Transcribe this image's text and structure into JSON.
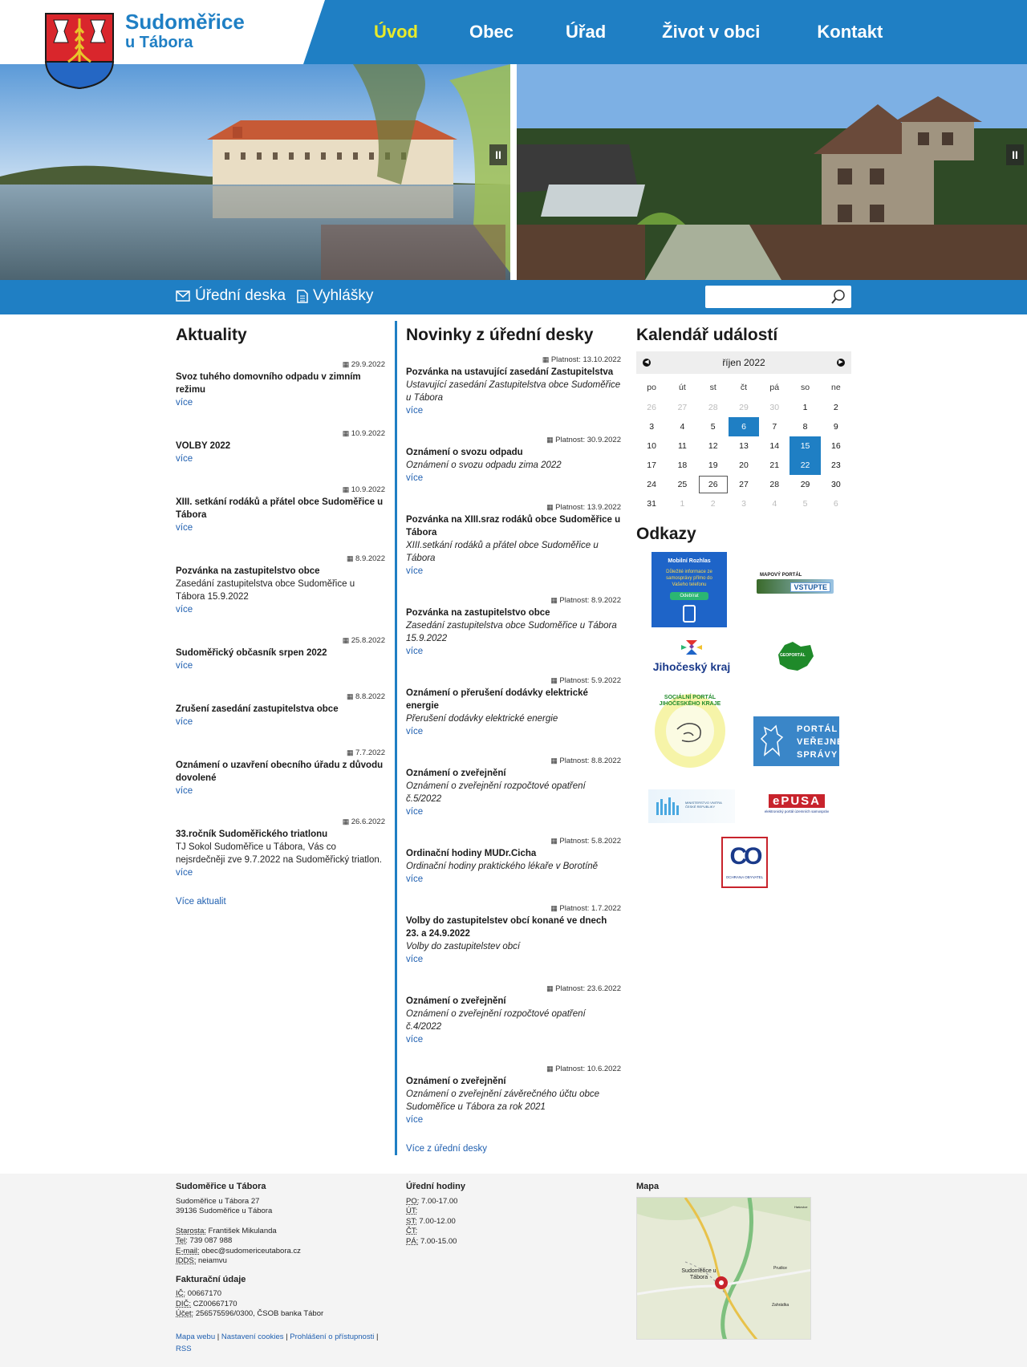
{
  "site": {
    "name_line1": "Sudoměřice",
    "name_line2": "u Tábora"
  },
  "nav": [
    {
      "label": "Úvod",
      "active": true
    },
    {
      "label": "Obec"
    },
    {
      "label": "Úřad"
    },
    {
      "label": "Život v obci"
    },
    {
      "label": "Kontakt"
    }
  ],
  "bar": {
    "official_board": "Úřední deska",
    "decrees": "Vyhlášky",
    "search_placeholder": ""
  },
  "aktuality": {
    "title": "Aktuality",
    "items": [
      {
        "date": "29.9.2022",
        "title": "Svoz tuhého domovního odpadu v zimním režimu",
        "desc": "",
        "more": "více"
      },
      {
        "date": "10.9.2022",
        "title": "VOLBY 2022",
        "desc": "",
        "more": "více"
      },
      {
        "date": "10.9.2022",
        "title": "XIII. setkání rodáků a přátel obce Sudoměřice u Tábora",
        "desc": "",
        "more": "více"
      },
      {
        "date": "8.9.2022",
        "title": "Pozvánka na zastupitelstvo obce",
        "desc": "Zasedání zastupitelstva obce Sudoměřice u Tábora 15.9.2022",
        "more": "více"
      },
      {
        "date": "25.8.2022",
        "title": "Sudoměřický občasník srpen 2022",
        "desc": "",
        "more": "více"
      },
      {
        "date": "8.8.2022",
        "title": "Zrušení zasedání zastupitelstva obce",
        "desc": "",
        "more": "více"
      },
      {
        "date": "7.7.2022",
        "title": "Oznámení o uzavření obecního úřadu z důvodu dovolené",
        "desc": "",
        "more": "více"
      },
      {
        "date": "26.6.2022",
        "title": "33.ročník Sudoměřického triatlonu",
        "desc": "TJ Sokol Sudoměřice u Tábora, Vás co nejsrdečněji zve 9.7.2022 na Sudoměřický triatlon.",
        "more": "více"
      }
    ],
    "all_link": "Více aktualit"
  },
  "novinky": {
    "title": "Novinky z úřední desky",
    "valid_label": "Platnost:",
    "items": [
      {
        "date": "13.10.2022",
        "title": "Pozvánka na ustavující zasedání Zastupitelstva",
        "desc": "Ustavující zasedání Zastupitelstva obce Sudoměřice u Tábora",
        "more": "více"
      },
      {
        "date": "30.9.2022",
        "title": "Oznámení o svozu odpadu",
        "desc": "Oznámení o svozu odpadu zima 2022",
        "more": "více"
      },
      {
        "date": "13.9.2022",
        "title": "Pozvánka na XIII.sraz rodáků obce Sudoměřice u Tábora",
        "desc": "XIII.setkání rodáků a přátel obce Sudoměřice u Tábora",
        "more": "více"
      },
      {
        "date": "8.9.2022",
        "title": "Pozvánka na zastupitelstvo obce",
        "desc": "Zasedání zastupitelstva obce Sudoměřice u Tábora 15.9.2022",
        "more": "více"
      },
      {
        "date": "5.9.2022",
        "title": "Oznámení o přerušení dodávky elektrické energie",
        "desc": "Přerušení dodávky elektrické energie",
        "more": "více"
      },
      {
        "date": "8.8.2022",
        "title": "Oznámení o zveřejnění",
        "desc": "Oznámení o zveřejnění rozpočtové opatření č.5/2022",
        "more": "více"
      },
      {
        "date": "5.8.2022",
        "title": "Ordinační hodiny MUDr.Cicha",
        "desc": "Ordinační hodiny praktického lékaře v Borotíně",
        "more": "více"
      },
      {
        "date": "1.7.2022",
        "title": "Volby do zastupitelstev obcí konané ve dnech 23. a 24.9.2022",
        "desc": "Volby do zastupitelstev obcí",
        "more": "více"
      },
      {
        "date": "23.6.2022",
        "title": "Oznámení o zveřejnění",
        "desc": "Oznámení o zveřejnění rozpočtové opatření č.4/2022",
        "more": "více"
      },
      {
        "date": "10.6.2022",
        "title": "Oznámení o zveřejnění",
        "desc": "Oznámení o zveřejnění závěrečného účtu obce Sudoměřice u Tábora za rok 2021",
        "more": "více"
      }
    ],
    "all_link": "Více z úřední desky"
  },
  "calendar": {
    "title": "Kalendář událostí",
    "month": "říjen 2022",
    "weekdays": [
      "po",
      "út",
      "st",
      "čt",
      "pá",
      "so",
      "ne"
    ],
    "weeks": [
      [
        "26",
        "27",
        "28",
        "29",
        "30",
        "1",
        "2"
      ],
      [
        "3",
        "4",
        "5",
        "6",
        "7",
        "8",
        "9"
      ],
      [
        "10",
        "11",
        "12",
        "13",
        "14",
        "15",
        "16"
      ],
      [
        "17",
        "18",
        "19",
        "20",
        "21",
        "22",
        "23"
      ],
      [
        "24",
        "25",
        "26",
        "27",
        "28",
        "29",
        "30"
      ],
      [
        "31",
        "1",
        "2",
        "3",
        "4",
        "5",
        "6"
      ]
    ],
    "event_days": [
      "6",
      "15",
      "22"
    ],
    "today": "26"
  },
  "odkazy": {
    "title": "Odkazy",
    "mobilni_rozhlas": {
      "name": "Mobilní Rozhlas",
      "text": "Důležité informace ze samosprávy přímo do Vašeho telefonu",
      "button": "Odebírat"
    },
    "mapovy_portal": {
      "label": "MAPOVÝ PORTÁL",
      "enter": "VSTUPTE"
    },
    "jihocesky_kraj": "Jihočeský kraj",
    "geoportal": "GEOPORTÁL",
    "socialni_portal": "SOCIÁLNÍ PORTÁL JIHOČESKÉHO KRAJE",
    "portal_verejne_spravy": [
      "PORTÁL",
      "VEŘEJNÉ",
      "SPRÁVY"
    ],
    "ministerstvo": "MINISTERSTVO VNITRA ČESKÉ REPUBLIKY",
    "epusa": {
      "name": "ePUSA",
      "sub": "elektronický portál územních samospráv"
    },
    "ochrana": {
      "mark": "CO",
      "label": "OCHRANA OBYVATEL"
    }
  },
  "footer": {
    "org": {
      "title": "Sudoměřice u Tábora",
      "addr1": "Sudoměřice u Tábora 27",
      "addr2": "39136 Sudoměřice u Tábora",
      "mayor_label": "Starosta:",
      "mayor": "František Mikulanda",
      "tel_label": "Tel:",
      "tel": "739 087 988",
      "email_label": "E-mail:",
      "email": "obec@sudomericeutabora.cz",
      "ids_label": "IDDS:",
      "ids": "neiamvu"
    },
    "billing": {
      "title": "Fakturační údaje",
      "ic_label": "IČ:",
      "ic": "00667170",
      "dic_label": "DIČ:",
      "dic": "CZ00667170",
      "account_label": "Účet:",
      "account": "256575596/0300, ČSOB banka Tábor"
    },
    "links": [
      "Mapa webu",
      "Nastavení cookies",
      "Prohlášení o přístupnosti",
      "RSS"
    ],
    "hours": {
      "title": "Úřední hodiny",
      "rows": [
        {
          "day": "PO:",
          "time": "7.00-17.00"
        },
        {
          "day": "ÚT:",
          "time": ""
        },
        {
          "day": "ST:",
          "time": "7.00-12.00"
        },
        {
          "day": "ČT:",
          "time": ""
        },
        {
          "day": "PÁ:",
          "time": "7.00-15.00"
        }
      ]
    },
    "map": {
      "title": "Mapa",
      "place": "Sudoměřice u Tábora",
      "towns": [
        "Prudice",
        "Zahrádka",
        "Hašovice"
      ]
    }
  },
  "colors": {
    "primary": "#1f7fc4",
    "active_nav": "#e8ea2a",
    "link": "#1f5fb0"
  }
}
